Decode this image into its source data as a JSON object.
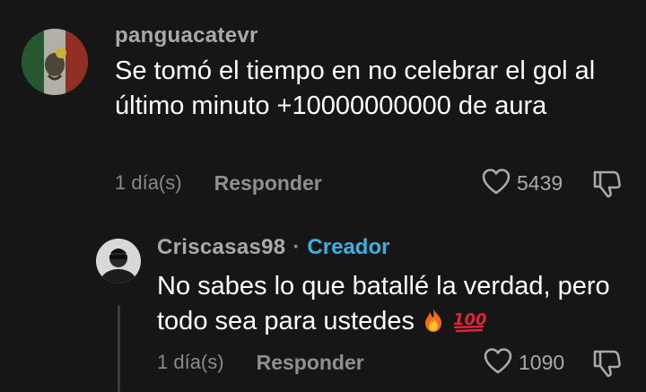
{
  "colors": {
    "background": "#161616",
    "username": "#a9a9a9",
    "body_text": "#ffffff",
    "meta_text": "#8a8a8a",
    "creator_badge": "#37b3e3",
    "thread_line": "#3c3c3c"
  },
  "comment": {
    "username": "panguacatevr",
    "text": "Se tomó el tiempo en no celebrar el gol al último minuto +10000000000 de aura",
    "time": "1 día(s)",
    "reply_label": "Responder",
    "like_count": "5439",
    "icons": {
      "avatar": "avatar-mexico-flag",
      "like": "heart-outline-icon",
      "dislike": "thumbs-down-icon"
    }
  },
  "reply": {
    "username": "Criscasas98",
    "separator": "·",
    "badge": "Creador",
    "text": "No sabes lo que batallé la verdad, pero todo sea para ustedes",
    "emojis": [
      "fire-emoji",
      "hundred-points-emoji"
    ],
    "time": "1 día(s)",
    "reply_label": "Responder",
    "like_count": "1090",
    "icons": {
      "avatar": "avatar-person-dark",
      "like": "heart-outline-icon",
      "dislike": "thumbs-down-icon"
    }
  }
}
